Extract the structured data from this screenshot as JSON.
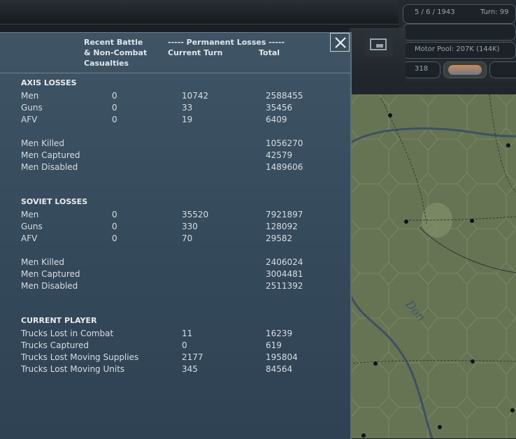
{
  "status": {
    "date": "5 / 6 / 1943",
    "turn": "Turn: 99",
    "motor_pool": "Motor Pool:  207K (144K)",
    "counter": "318"
  },
  "header": {
    "col1": "Recent Battle\n& Non-Combat\nCasualties",
    "perm": "----- Permanent Losses -----",
    "current": "Current Turn",
    "total": "Total"
  },
  "axis": {
    "title": "AXIS LOSSES",
    "rows": [
      {
        "label": "Men",
        "recent": "0",
        "current": "10742",
        "total": "2588455"
      },
      {
        "label": "Guns",
        "recent": "0",
        "current": "33",
        "total": "35456"
      },
      {
        "label": "AFV",
        "recent": "0",
        "current": "19",
        "total": "6409"
      }
    ],
    "extra": [
      {
        "label": "Men Killed",
        "total": "1056270"
      },
      {
        "label": "Men Captured",
        "total": "42579"
      },
      {
        "label": "Men Disabled",
        "total": "1489606"
      }
    ]
  },
  "soviet": {
    "title": "SOVIET LOSSES",
    "rows": [
      {
        "label": "Men",
        "recent": "0",
        "current": "35520",
        "total": "7921897"
      },
      {
        "label": "Guns",
        "recent": "0",
        "current": "330",
        "total": "128092"
      },
      {
        "label": "AFV",
        "recent": "0",
        "current": "70",
        "total": "29582"
      }
    ],
    "extra": [
      {
        "label": "Men Killed",
        "total": "2406024"
      },
      {
        "label": "Men Captured",
        "total": "3004481"
      },
      {
        "label": "Men Disabled",
        "total": "2511392"
      }
    ]
  },
  "player": {
    "title": "CURRENT PLAYER",
    "rows": [
      {
        "label": "Trucks Lost in Combat",
        "current": "11",
        "total": "16239"
      },
      {
        "label": "Trucks Captured",
        "current": "0",
        "total": "619"
      },
      {
        "label": "Trucks Lost Moving Supplies",
        "current": "2177",
        "total": "195804"
      },
      {
        "label": "Trucks Lost Moving Units",
        "current": "345",
        "total": "84564"
      }
    ]
  },
  "map": {
    "river_label": "Don"
  },
  "icons": {
    "close": "close-icon",
    "monitor": "monitor-icon"
  }
}
